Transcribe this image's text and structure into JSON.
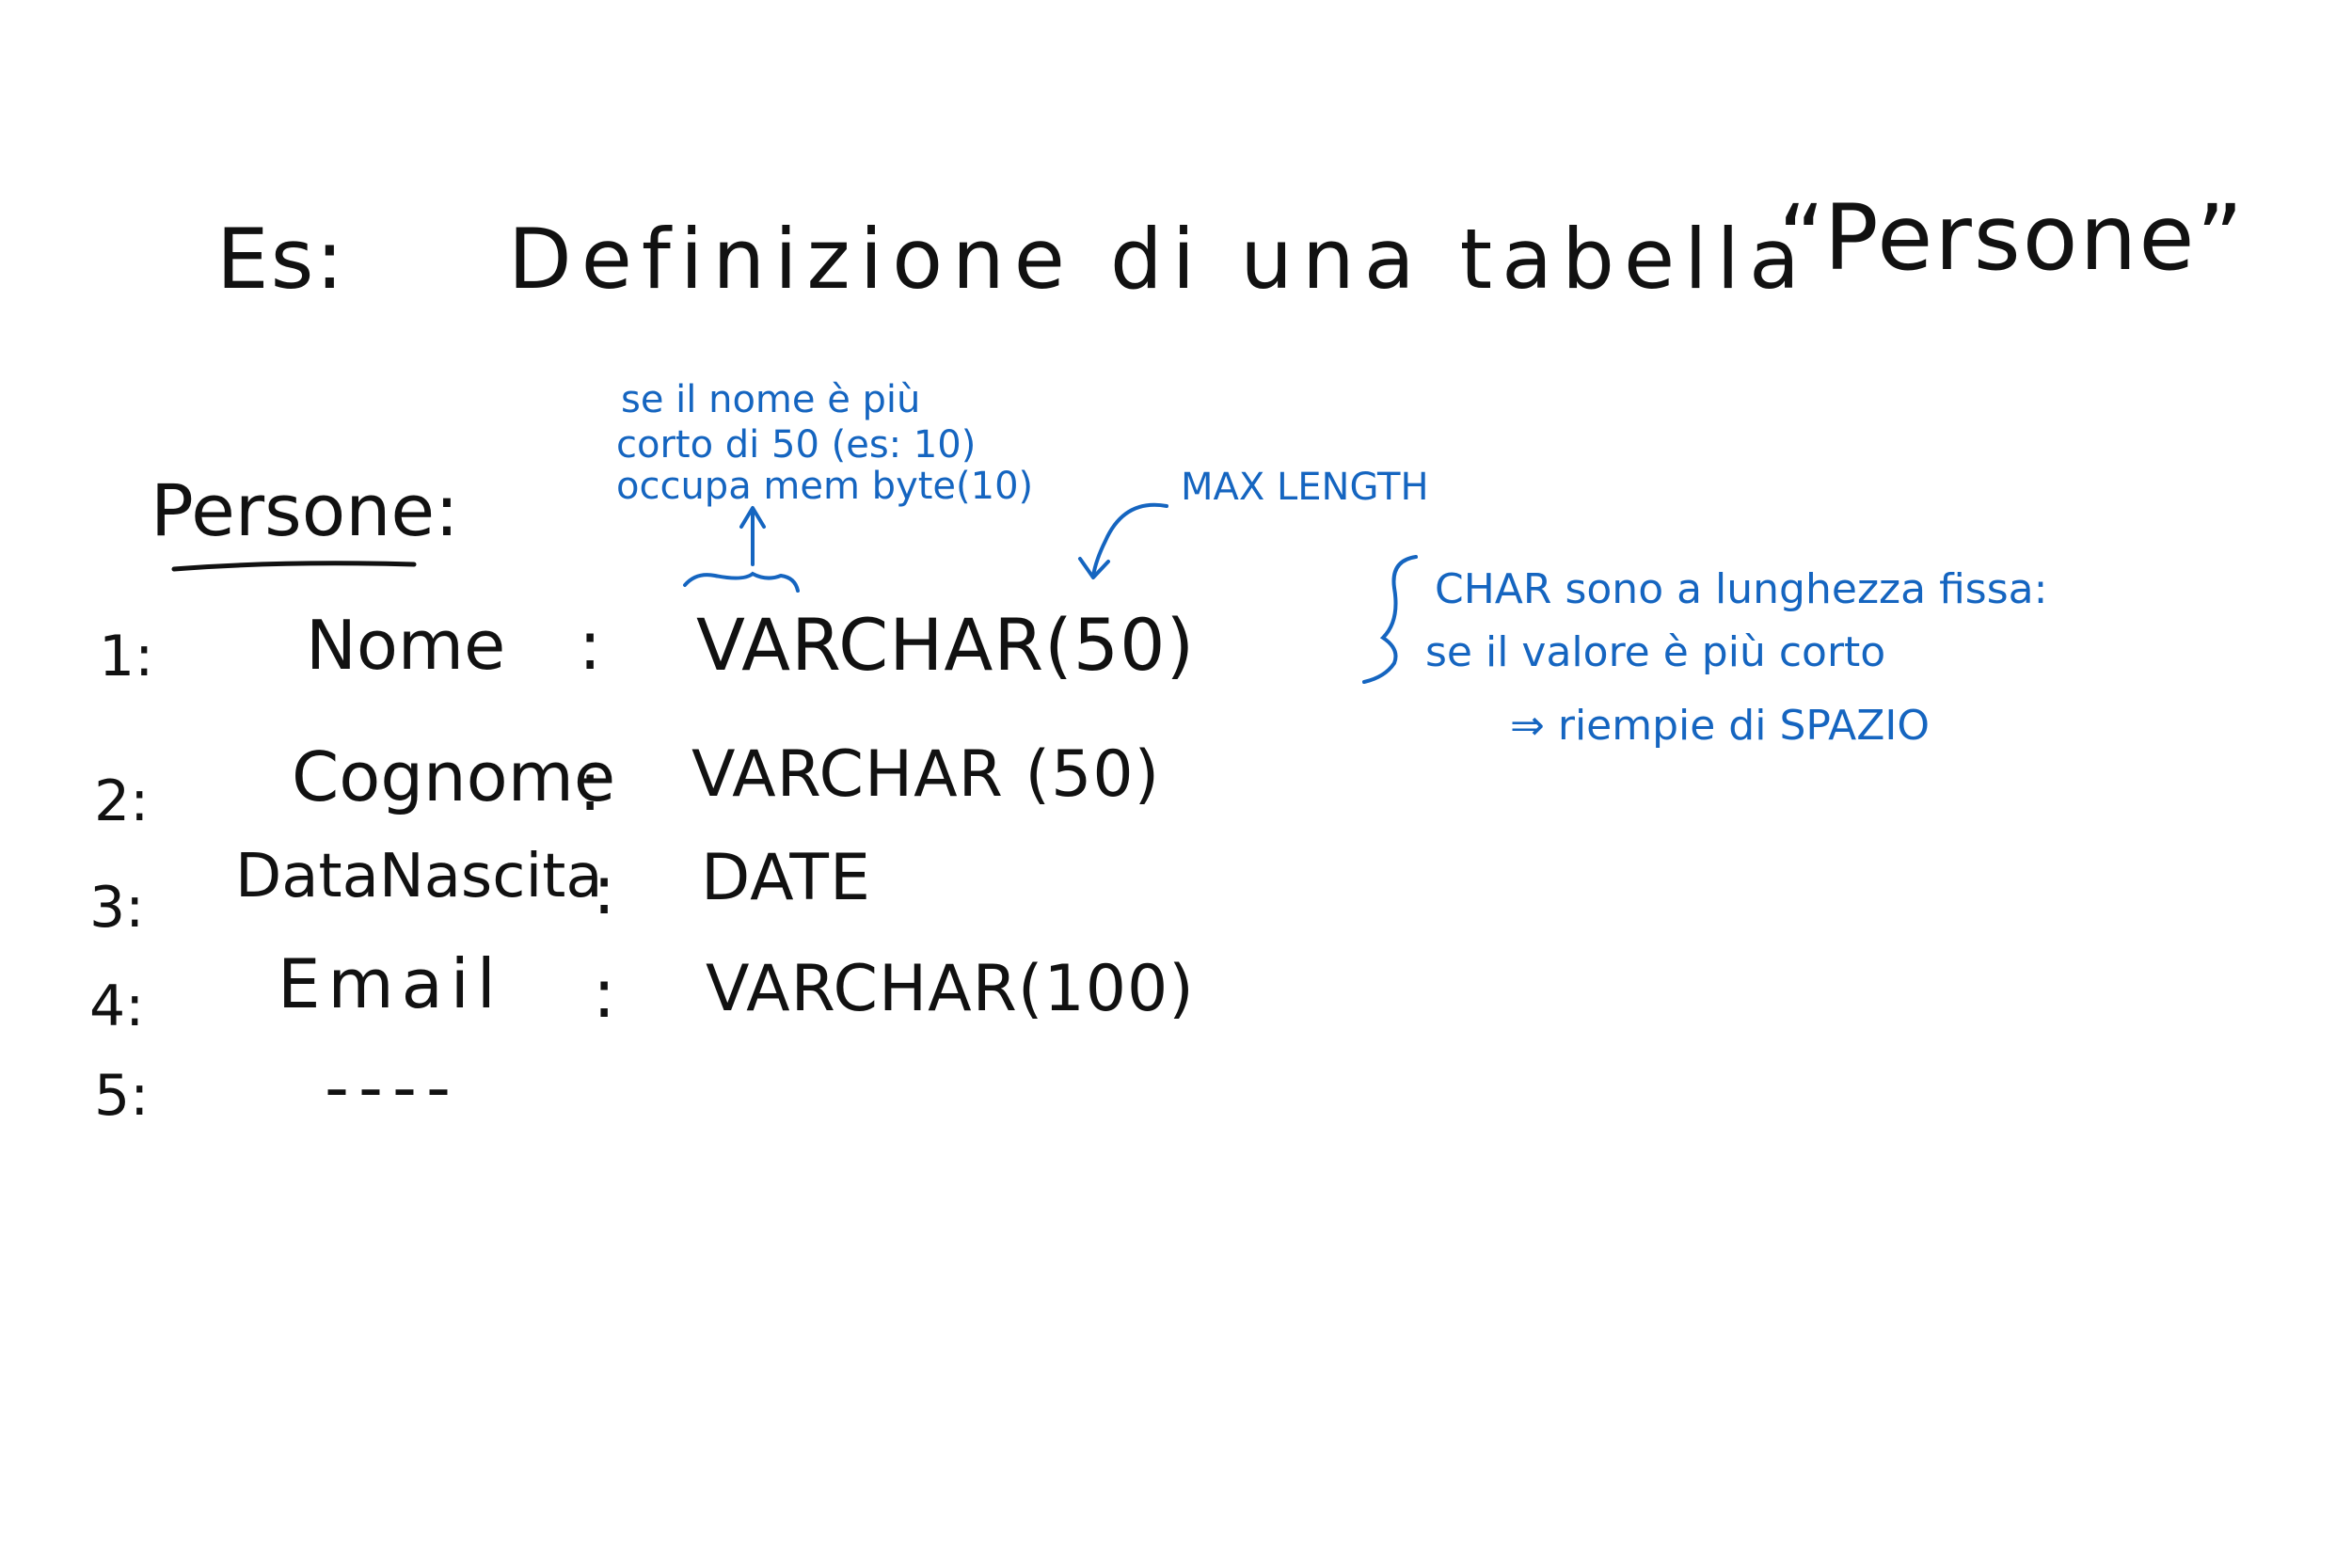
{
  "title": {
    "prefix": "Es:",
    "text": "Definizione di una tabella",
    "quoted": "“Persone”"
  },
  "table": {
    "name": "Persone:",
    "rows": [
      {
        "num": "1:",
        "field": "Nome",
        "sep": ":",
        "type": "VARCHAR(50)"
      },
      {
        "num": "2:",
        "field": "Cognome",
        "sep": ":",
        "type": "VARCHAR (50)"
      },
      {
        "num": "3:",
        "field": "DataNascita",
        "sep": ":",
        "type": "DATE"
      },
      {
        "num": "4:",
        "field": "Email",
        "sep": ":",
        "type": "VARCHAR(100)"
      },
      {
        "num": "5:",
        "field": "----",
        "sep": "",
        "type": ""
      }
    ]
  },
  "annotations": {
    "varchar_note": [
      "se il nome è più",
      "corto di 50 (es: 10)",
      "occupa mem byte(10)"
    ],
    "max_length": "MAX LENGTH",
    "char_note": [
      "CHAR sono a lunghezza fissa:",
      "se il valore è più corto",
      "⇒ riempie di SPAZIO"
    ]
  },
  "colors": {
    "ink": "#111111",
    "annotation": "#1565C0",
    "background": "#ffffff"
  }
}
